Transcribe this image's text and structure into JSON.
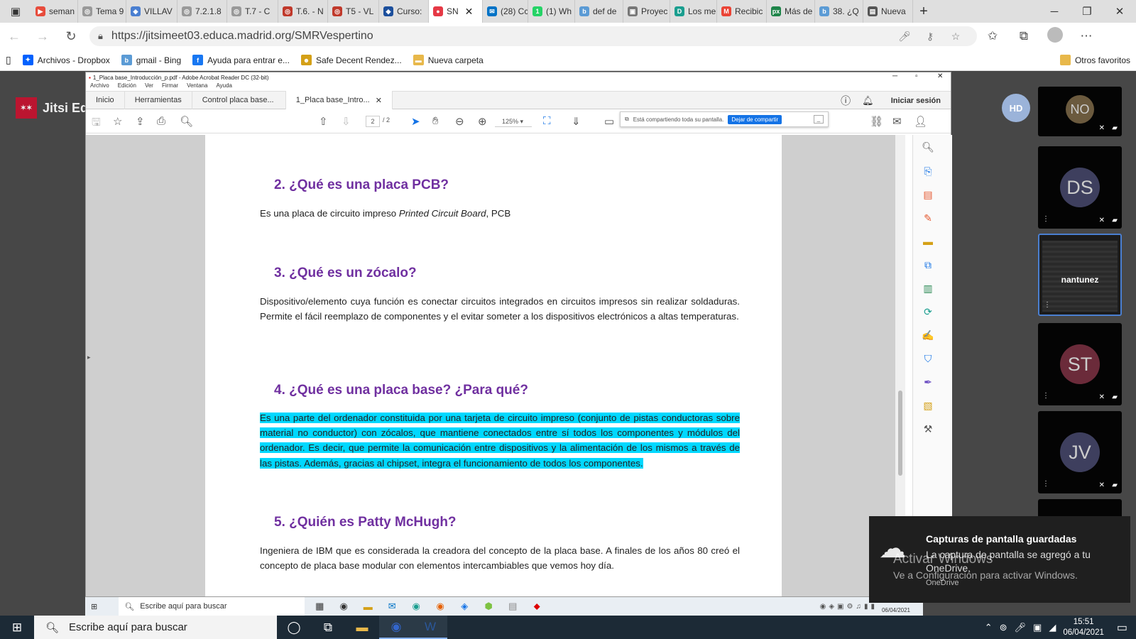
{
  "browser": {
    "tabs": [
      {
        "label": "seman",
        "color": "#e74c3c",
        "glyph": "▶"
      },
      {
        "label": "Tema 9",
        "color": "#999999",
        "glyph": "◎"
      },
      {
        "label": "VILLAV",
        "color": "#4a7fd1",
        "glyph": "◆"
      },
      {
        "label": "7.2.1.8",
        "color": "#999999",
        "glyph": "◎"
      },
      {
        "label": "T.7 - C",
        "color": "#999999",
        "glyph": "◎"
      },
      {
        "label": "T.6. - N",
        "color": "#c0392b",
        "glyph": "◎"
      },
      {
        "label": "T5 - VL",
        "color": "#c0392b",
        "glyph": "◎"
      },
      {
        "label": "Curso:",
        "color": "#1c4f9c",
        "glyph": "◆"
      },
      {
        "label": "SN",
        "color": "#e63946",
        "glyph": "●"
      },
      {
        "label": "(28) Cc",
        "color": "#0072c6",
        "glyph": "✉"
      },
      {
        "label": "(1) Wh",
        "color": "#25d366",
        "glyph": "1"
      },
      {
        "label": "def de",
        "color": "#5b9bd5",
        "glyph": "b"
      },
      {
        "label": "Proyec",
        "color": "#777777",
        "glyph": "▣"
      },
      {
        "label": "Los me",
        "color": "#1a9e8f",
        "glyph": "D"
      },
      {
        "label": "Recibic",
        "color": "#ea4335",
        "glyph": "M"
      },
      {
        "label": "Más de",
        "color": "#1e8449",
        "glyph": "px"
      },
      {
        "label": "38. ¿Q",
        "color": "#5b9bd5",
        "glyph": "b"
      },
      {
        "label": "Nueva",
        "color": "#555555",
        "glyph": "▤"
      }
    ],
    "active_tab_index": 8,
    "url": "https://jitsimeet03.educa.madrid.org/SMRVespertino",
    "bookmarks": [
      {
        "label": "Archivos - Dropbox",
        "color": "#0061fe",
        "glyph": "✦"
      },
      {
        "label": "gmail - Bing",
        "color": "#5b9bd5",
        "glyph": "b"
      },
      {
        "label": "Ayuda para entrar e...",
        "color": "#1877f2",
        "glyph": "f"
      },
      {
        "label": "Safe Decent Rendez...",
        "color": "#d4a017",
        "glyph": "☻"
      },
      {
        "label": "Nueva carpeta",
        "color": "#e8b84a",
        "glyph": "▬"
      }
    ],
    "other_favorites": "Otros favoritos"
  },
  "jitsi": {
    "logo_text": "Jitsi Ed",
    "local_avatar": "HD",
    "participants": [
      {
        "initials": "NO",
        "color": "#6b5a3e"
      },
      {
        "initials": "DS",
        "color": "#3e3f5e"
      },
      {
        "name": "nantunez",
        "speaker": true
      },
      {
        "initials": "ST",
        "color": "#6b2b3a"
      },
      {
        "initials": "JV",
        "color": "#3e3f5e"
      }
    ]
  },
  "acrobat": {
    "window_title": "1_Placa base_Introducción_p.pdf - Adobe Acrobat Reader DC (32-bit)",
    "menu": [
      "Archivo",
      "Edición",
      "Ver",
      "Firmar",
      "Ventana",
      "Ayuda"
    ],
    "tabs": [
      "Inicio",
      "Herramientas",
      "Control placa base...",
      "1_Placa base_Intro..."
    ],
    "signin": "Iniciar sesión",
    "page_current": "2",
    "page_total": "/ 2",
    "zoom": "125%",
    "share_msg": "Está compartiendo toda su pantalla.",
    "share_stop": "Dejar de compartir",
    "share_min": "_"
  },
  "document": {
    "s2_title": "2.  ¿Qué es una placa PCB?",
    "s2_text_a": "Es una placa de circuito impreso ",
    "s2_text_em": "Printed Circuit Board",
    "s2_text_b": ", PCB",
    "s3_title": "3.  ¿Qué es un zócalo?",
    "s3_text": "Dispositivo/elemento cuya función es conectar circuitos integrados en circuitos impresos sin realizar soldaduras. Permite el fácil reemplazo de componentes y el evitar someter a los dispositivos electrónicos a altas temperaturas.",
    "s4_title": "4.  ¿Qué es una placa base? ¿Para qué?",
    "s4_text": "Es una parte del ordenador constituida por una tarjeta de circuito impreso (conjunto de pistas conductoras sobre material no conductor) con zócalos, que mantiene conectados entre sí todos los componentes y módulos del ordenador. Es decir, que permite la comunicación entre dispositivos y la alimentación de los mismos a través de las pistas. Además, gracias al chipset, integra el funcionamiento de todos los componentes.",
    "s5_title": "5.  ¿Quién es Patty McHugh?",
    "s5_text": "Ingeniera de IBM que es considerada la creadora del concepto de la placa base. A finales de los  años 80 creó el concepto de placa base modular con elementos intercambiables que vemos hoy día."
  },
  "inner_taskbar": {
    "search_placeholder": "Escribe aquí para buscar",
    "date": "06/04/2021"
  },
  "toast": {
    "title": "Capturas de pantalla guardadas",
    "body": "La captura de pantalla se agregó a tu OneDrive.",
    "source": "OneDrive"
  },
  "watermark": {
    "line1": "Activar Windows",
    "line2": "Ve a Configuración para activar Windows."
  },
  "taskbar": {
    "search_placeholder": "Escribe aquí para buscar",
    "time": "15:51",
    "date": "06/04/2021"
  }
}
